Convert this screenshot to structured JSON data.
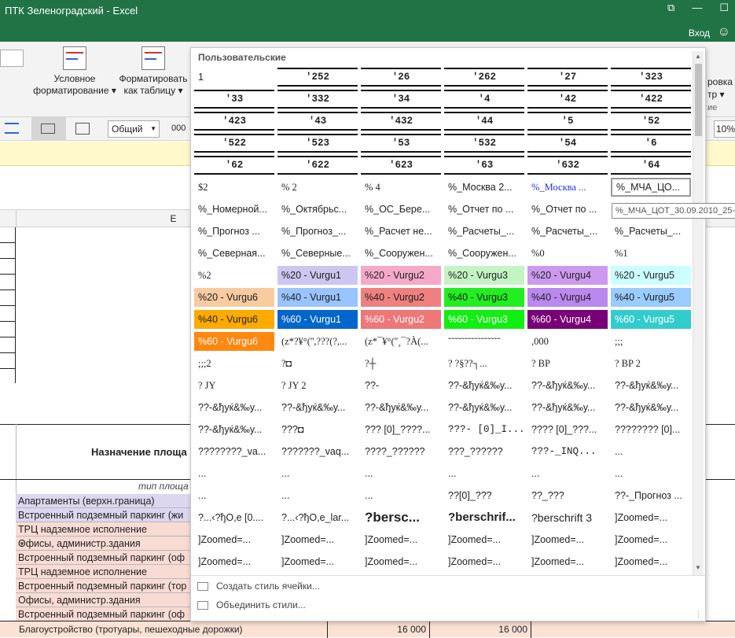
{
  "app": {
    "title": "ПТК Зеленоградский - Excel",
    "win_controls": [
      "⧉",
      "—",
      "☐"
    ],
    "login": "Вход"
  },
  "ribbon": {
    "btn_cond": {
      "line1": "Условное",
      "line2": "форматирование ▾"
    },
    "btn_table": {
      "line1": "Форматировать",
      "line2": "как таблицу ▾"
    },
    "right_text1": "ровка",
    "right_text2": "тр ▾",
    "right_text3": "ие",
    "number_format": "Общий",
    "zeros": "000",
    "zoom": "10%"
  },
  "sheet": {
    "col_e": "E",
    "header_text": "Назначение площа",
    "subheader": "тип площа",
    "rows": [
      {
        "text": "Апартаменты (верхн.граница)",
        "color": "#dcd6ef"
      },
      {
        "text": "Встроенный подземный паркинг (жи",
        "color": "#dcd6ef"
      },
      {
        "text": "ТРЦ надземное исполнение",
        "color": "#f8dbd3"
      },
      {
        "text": "Офисы, администр.здания",
        "color": "#f8dbd3"
      },
      {
        "text": "Встроенный подземный паркинг (оф",
        "color": "#f8dbd3"
      },
      {
        "text": "ТРЦ надземное исполнение",
        "color": "#f8dbd3"
      },
      {
        "text": "Встроенный подземный паркинг (тор",
        "color": "#f8dbd3"
      },
      {
        "text": "Офисы, администр.здания",
        "color": "#f8dbd3"
      },
      {
        "text": "Встроенный подземный паркинг (оф",
        "color": "#f8dbd3"
      }
    ],
    "bottom_row": {
      "text": "Благоустройство (тротуары, пешеходные дорожки)",
      "v1": "16 000",
      "v2": "16 000"
    }
  },
  "gallery": {
    "header": "Пользовательские",
    "tooltip": "%_МЧА_ЦОТ_30.09.2010_25-",
    "styles": [
      {
        "t": "1"
      },
      {
        "t": "'252",
        "k": "b"
      },
      {
        "t": "'26",
        "k": "b"
      },
      {
        "t": "'262",
        "k": "b"
      },
      {
        "t": "'27",
        "k": "b"
      },
      {
        "t": "'323",
        "k": "b"
      },
      {
        "t": "'33",
        "k": "b"
      },
      {
        "t": "'332",
        "k": "b"
      },
      {
        "t": "'34",
        "k": "b"
      },
      {
        "t": "'4",
        "k": "b"
      },
      {
        "t": "'42",
        "k": "b"
      },
      {
        "t": "'422",
        "k": "b"
      },
      {
        "t": "'423",
        "k": "b"
      },
      {
        "t": "'43",
        "k": "b"
      },
      {
        "t": "'432",
        "k": "b"
      },
      {
        "t": "'44",
        "k": "b"
      },
      {
        "t": "'5",
        "k": "b"
      },
      {
        "t": "'52",
        "k": "b"
      },
      {
        "t": "'522",
        "k": "b"
      },
      {
        "t": "'523",
        "k": "b"
      },
      {
        "t": "'53",
        "k": "b"
      },
      {
        "t": "'532",
        "k": "b"
      },
      {
        "t": "'54",
        "k": "b"
      },
      {
        "t": "'6",
        "k": "b"
      },
      {
        "t": "'62",
        "k": "b"
      },
      {
        "t": "'622",
        "k": "b"
      },
      {
        "t": "'623",
        "k": "b"
      },
      {
        "t": "'63",
        "k": "b"
      },
      {
        "t": "'632",
        "k": "b"
      },
      {
        "t": "'64",
        "k": "b"
      },
      {
        "t": "$2",
        "f": "serif"
      },
      {
        "t": "% 2",
        "f": "serif"
      },
      {
        "t": "% 4",
        "f": "serif"
      },
      {
        "t": "%_Москва 2..."
      },
      {
        "t": "%_Москва ...",
        "fg": "#2233dd",
        "f": "serif"
      },
      {
        "t": "%_МЧА_ЦО...",
        "k": "sel"
      },
      {
        "t": "%_Номерной..."
      },
      {
        "t": "%_Октябрьс..."
      },
      {
        "t": "%_ОС_Бере..."
      },
      {
        "t": "%_Отчет по ..."
      },
      {
        "t": "%_Отчет по ..."
      },
      {
        "t": "%_Прогноз..."
      },
      {
        "t": "%_Прогноз ..."
      },
      {
        "t": "%_Прогноз_..."
      },
      {
        "t": "%_Расчет не..."
      },
      {
        "t": "%_Расчеты_..."
      },
      {
        "t": "%_Расчеты_..."
      },
      {
        "t": "%_Расчеты_..."
      },
      {
        "t": "%_Северная..."
      },
      {
        "t": "%_Северные..."
      },
      {
        "t": "%_Сооружен..."
      },
      {
        "t": "%_Сооружен..."
      },
      {
        "t": "%0",
        "f": "serif"
      },
      {
        "t": "%1",
        "f": "serif"
      },
      {
        "t": "%2",
        "f": "serif"
      },
      {
        "t": "%20 - Vurgu1",
        "bg": "#ccc6f0"
      },
      {
        "t": "%20 - Vurgu2",
        "bg": "#f4a9c9"
      },
      {
        "t": "%20 - Vurgu3",
        "bg": "#c4f4c4"
      },
      {
        "t": "%20 - Vurgu4",
        "bg": "#cc99ee"
      },
      {
        "t": "%20 - Vurgu5",
        "bg": "#ccffff"
      },
      {
        "t": "%20 - Vurgu6",
        "bg": "#f8cba0"
      },
      {
        "t": "%40 - Vurgu1",
        "bg": "#99c4ff"
      },
      {
        "t": "%40 - Vurgu2",
        "bg": "#f08080"
      },
      {
        "t": "%40 - Vurgu3",
        "bg": "#22ee22"
      },
      {
        "t": "%40 - Vurgu4",
        "bg": "#bb88ee"
      },
      {
        "t": "%40 - Vurgu5",
        "bg": "#99ccff"
      },
      {
        "t": "%40 - Vurgu6",
        "bg": "#ffaa00"
      },
      {
        "t": "%60 - Vurgu1",
        "bg": "#0066cc",
        "fg": "#fff"
      },
      {
        "t": "%60 - Vurgu2",
        "bg": "#ee7777",
        "fg": "#fff"
      },
      {
        "t": "%60 - Vurgu3",
        "bg": "#11ee11",
        "fg": "#fff"
      },
      {
        "t": "%60 - Vurgu4",
        "bg": "#770077",
        "fg": "#fff"
      },
      {
        "t": "%60 - Vurgu5",
        "bg": "#33cccc",
        "fg": "#fff"
      },
      {
        "t": "%60 - Vurgu6",
        "bg": "#ff8811",
        "fg": "#fff"
      },
      {
        "t": "(z*?¥°('',???(?,...",
        "f": "serif"
      },
      {
        "t": "(z*¯¥°(''¸¯?À(...",
        "f": "serif"
      },
      {
        "t": "˜˜˜˜˜˜˜˜˜˜˜˜˜˜˜˜",
        "f": "serif"
      },
      {
        "t": ",000",
        "f": "serif"
      },
      {
        "t": ";;;",
        "f": "serif"
      },
      {
        "t": ";;;2",
        "f": "serif"
      },
      {
        "t": "?◘",
        "f": "serif"
      },
      {
        "t": "?┼",
        "f": "serif"
      },
      {
        "t": "?     ?§??┐...",
        "f": "serif"
      },
      {
        "t": "? BP",
        "f": "serif"
      },
      {
        "t": "? BP 2",
        "f": "serif"
      },
      {
        "t": "? JY",
        "f": "serif"
      },
      {
        "t": "? JY 2",
        "f": "serif"
      },
      {
        "t": "??-"
      },
      {
        "t": "??-&ђуќ&‰у..."
      },
      {
        "t": "??-&ђуќ&‰у..."
      },
      {
        "t": "??-&ђуќ&‰у..."
      },
      {
        "t": "??-&ђуќ&‰у..."
      },
      {
        "t": "??-&ђуќ&‰у..."
      },
      {
        "t": "??-&ђуќ&‰у..."
      },
      {
        "t": "??-&ђуќ&‰у..."
      },
      {
        "t": "??-&ђуќ&‰у..."
      },
      {
        "t": "??-&ђуќ&‰у..."
      },
      {
        "t": "??-&ђуќ&‰у..."
      },
      {
        "t": "???◘"
      },
      {
        "t": "??? [0]_????..."
      },
      {
        "t": "???- [0]_I...",
        "f": "mono"
      },
      {
        "t": "???? [0]_???..."
      },
      {
        "t": "???????? [0]..."
      },
      {
        "t": "????????_va..."
      },
      {
        "t": "???????_vaq..."
      },
      {
        "t": "????_??????"
      },
      {
        "t": "???_??????"
      },
      {
        "t": "???-_INQ...",
        "f": "mono"
      },
      {
        "t": "..."
      },
      {
        "t": "..."
      },
      {
        "t": "..."
      },
      {
        "t": "..."
      },
      {
        "t": "..."
      },
      {
        "t": "..."
      },
      {
        "t": "..."
      },
      {
        "t": "..."
      },
      {
        "t": "..."
      },
      {
        "t": "..."
      },
      {
        "t": "??[0]_???"
      },
      {
        "t": "??_???"
      },
      {
        "t": "??-_Прогноз ..."
      },
      {
        "t": "?...‹?ђO,e [0...."
      },
      {
        "t": "?...‹?ђO,e_lar..."
      },
      {
        "t": "?bersc...",
        "bold": true,
        "size": "17px"
      },
      {
        "t": "?berschrif...",
        "bold": true,
        "size": "15px"
      },
      {
        "t": "?berschrift 3",
        "size": "14px"
      },
      {
        "t": "]Zoomed=..."
      },
      {
        "t": "]Zoomed=..."
      },
      {
        "t": "]Zoomed=..."
      },
      {
        "t": "]Zoomed=..."
      },
      {
        "t": "]Zoomed=..."
      },
      {
        "t": "]Zoomed=..."
      },
      {
        "t": "]Zoomed=..."
      },
      {
        "t": "]Zoomed=..."
      },
      {
        "t": "]Zoomed=..."
      },
      {
        "t": "]Zoomed=..."
      },
      {
        "t": "]Zoomed=..."
      },
      {
        "t": "]Zoomed=..."
      },
      {
        "t": "]Zoomed=..."
      }
    ],
    "actions": {
      "new_style": "Создать стиль ячейки...",
      "merge": "Объединить стили..."
    }
  }
}
